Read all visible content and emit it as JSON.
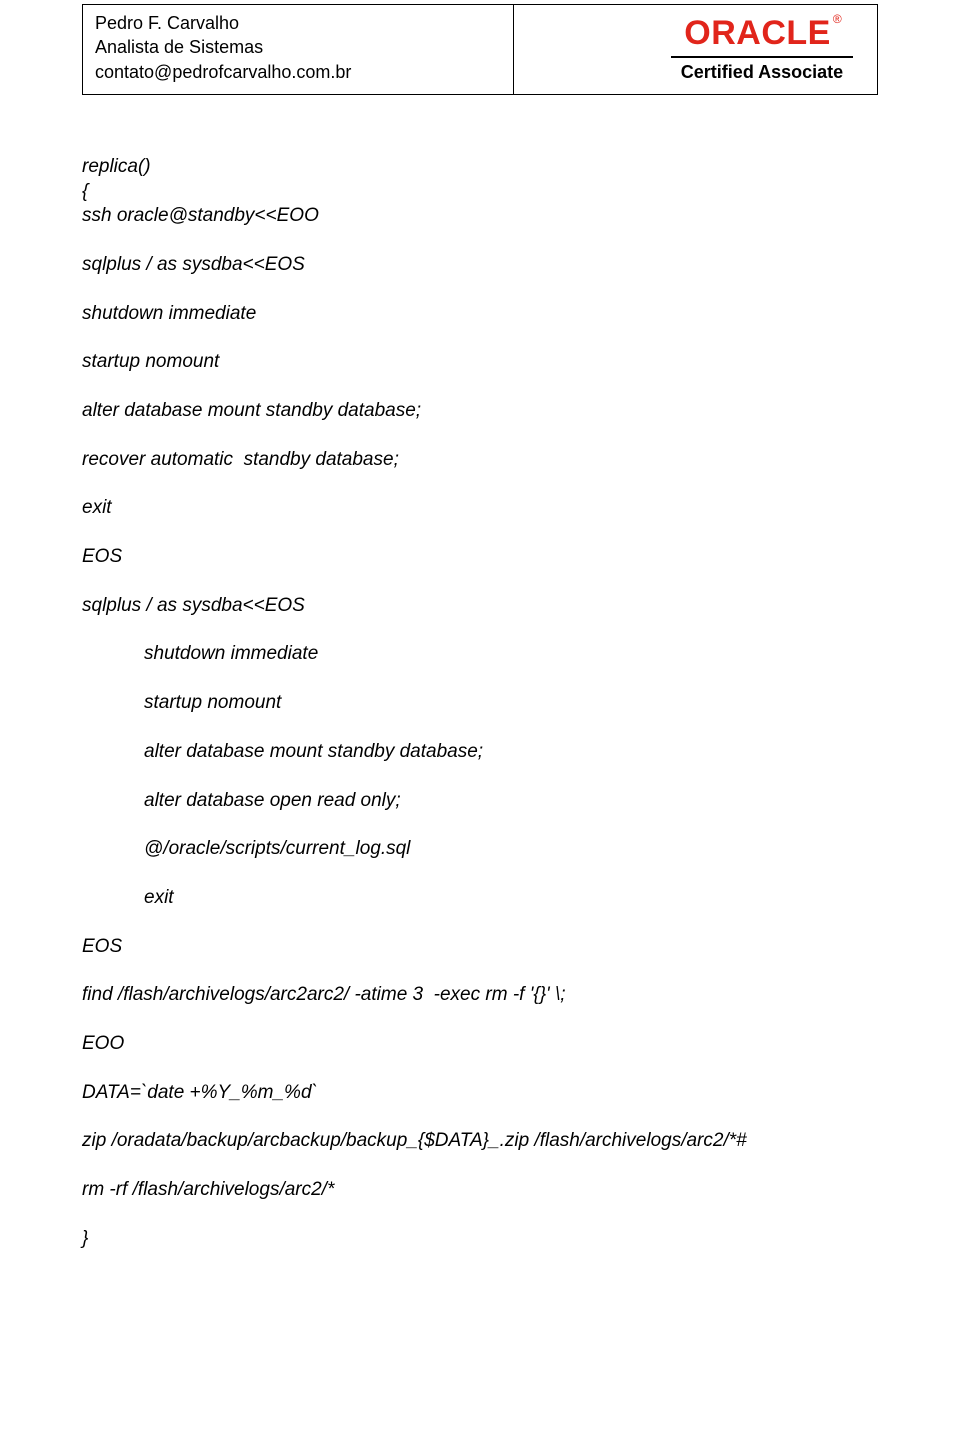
{
  "header": {
    "name": "Pedro F. Carvalho",
    "title": "Analista de Sistemas",
    "email": "contato@pedrofcarvalho.com.br",
    "badge_word": "ORACLE",
    "badge_sub": "Certified Associate"
  },
  "code": {
    "l1": "replica()",
    "l2": "{",
    "l3": "ssh oracle@standby<<EOO",
    "l4": "sqlplus / as sysdba<<EOS",
    "l5": "shutdown immediate",
    "l6": "startup nomount",
    "l7": "alter database mount standby database;",
    "l8": "recover automatic  standby database;",
    "l9": "exit",
    "l10": "EOS",
    "l11": "sqlplus / as sysdba<<EOS",
    "l12": "shutdown immediate",
    "l13": "startup nomount",
    "l14": "alter database mount standby database;",
    "l15": "alter database open read only;",
    "l16": "@/oracle/scripts/current_log.sql",
    "l17": "exit",
    "l18": "EOS",
    "l19": "find /flash/archivelogs/arc2arc2/ -atime 3  -exec rm -f '{}' \\;",
    "l20": "EOO",
    "l21": "DATA=`date +%Y_%m_%d`",
    "l22": "zip /oradata/backup/arcbackup/backup_{$DATA}_.zip /flash/archivelogs/arc2/*#",
    "l23": "rm -rf /flash/archivelogs/arc2/*",
    "l24": "}"
  }
}
